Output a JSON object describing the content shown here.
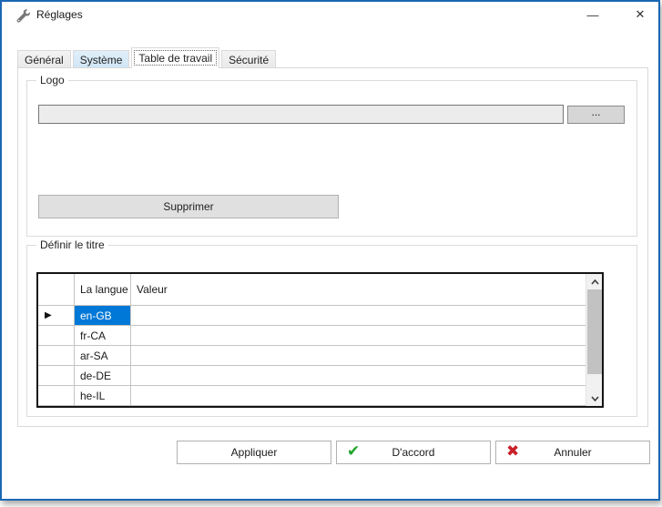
{
  "window": {
    "title": "Réglages"
  },
  "titlebar": {
    "minimize_glyph": "—",
    "close_glyph": "✕"
  },
  "tabs": [
    {
      "label": "Général",
      "state": "inactive"
    },
    {
      "label": "Système",
      "state": "hover"
    },
    {
      "label": "Table de travail",
      "state": "active"
    },
    {
      "label": "Sécurité",
      "state": "inactive"
    }
  ],
  "logo_group": {
    "label": "Logo",
    "path_value": "",
    "browse_label": "...",
    "delete_label": "Supprimer"
  },
  "title_group": {
    "label": "Définir le titre",
    "grid": {
      "columns": [
        "La langue",
        "Valeur"
      ],
      "current_row_marker": "▶",
      "selected_row": 0,
      "selected_cell": "en-GB",
      "rows": [
        {
          "lang": "en-GB",
          "value": ""
        },
        {
          "lang": "fr-CA",
          "value": ""
        },
        {
          "lang": "ar-SA",
          "value": ""
        },
        {
          "lang": "de-DE",
          "value": ""
        },
        {
          "lang": "he-IL",
          "value": ""
        }
      ]
    }
  },
  "footer": {
    "apply_label": "Appliquer",
    "ok_label": "D'accord",
    "ok_icon_glyph": "✔",
    "cancel_label": "Annuler",
    "cancel_icon_glyph": "✖"
  },
  "colors": {
    "accent_border": "#1a68b4",
    "selection": "#0078d7",
    "ok_icon": "#1ea32a",
    "cancel_icon": "#c9202b"
  }
}
